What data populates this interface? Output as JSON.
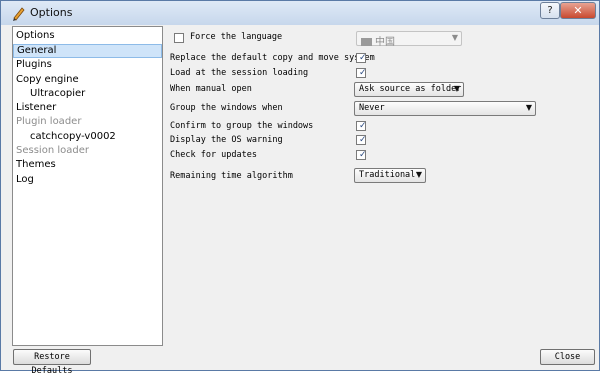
{
  "window": {
    "title": "Options",
    "help_label": "?",
    "close_label": "✕"
  },
  "nav": {
    "header": "Options",
    "items": [
      {
        "label": "General",
        "state": "selected",
        "level": 0
      },
      {
        "label": "Plugins",
        "state": "normal",
        "level": 0
      },
      {
        "label": "Copy engine",
        "state": "normal",
        "level": 0
      },
      {
        "label": "Ultracopier",
        "state": "normal",
        "level": 1
      },
      {
        "label": "Listener",
        "state": "normal",
        "level": 0
      },
      {
        "label": "Plugin loader",
        "state": "disabled",
        "level": 0
      },
      {
        "label": "catchcopy-v0002",
        "state": "normal",
        "level": 1
      },
      {
        "label": "Session loader",
        "state": "disabled",
        "level": 0
      },
      {
        "label": "Themes",
        "state": "normal",
        "level": 0
      },
      {
        "label": "Log",
        "state": "normal",
        "level": 0
      }
    ]
  },
  "general": {
    "force_language": {
      "label": "Force the language",
      "checked": false,
      "value": "中国"
    },
    "replace_copy": {
      "label": "Replace the default copy and move system",
      "checked": true
    },
    "load_at_session": {
      "label": "Load at the session loading",
      "checked": true
    },
    "manual_open": {
      "label": "When manual open",
      "value": "Ask source as folder"
    },
    "group_windows": {
      "label": "Group the windows when",
      "value": "Never"
    },
    "confirm_group": {
      "label": "Confirm to group the windows",
      "checked": true
    },
    "display_os_warning": {
      "label": "Display the OS warning",
      "checked": true
    },
    "check_updates": {
      "label": "Check for updates",
      "checked": true
    },
    "remaining_time": {
      "label": "Remaining time algorithm",
      "value": "Traditional"
    }
  },
  "footer": {
    "restore_label": "Restore Defaults",
    "close_label": "Close"
  },
  "icons": {
    "app": "ultracopier-logo-icon",
    "flag": "flag-icon",
    "check": "checkmark-icon",
    "dropdown": "chevron-down-icon"
  },
  "colors": {
    "selection": "#cfe4f9",
    "title_gradient_top": "#dfe9f6",
    "close_button": "#c8492f",
    "disabled_text": "#8c8c8c"
  }
}
